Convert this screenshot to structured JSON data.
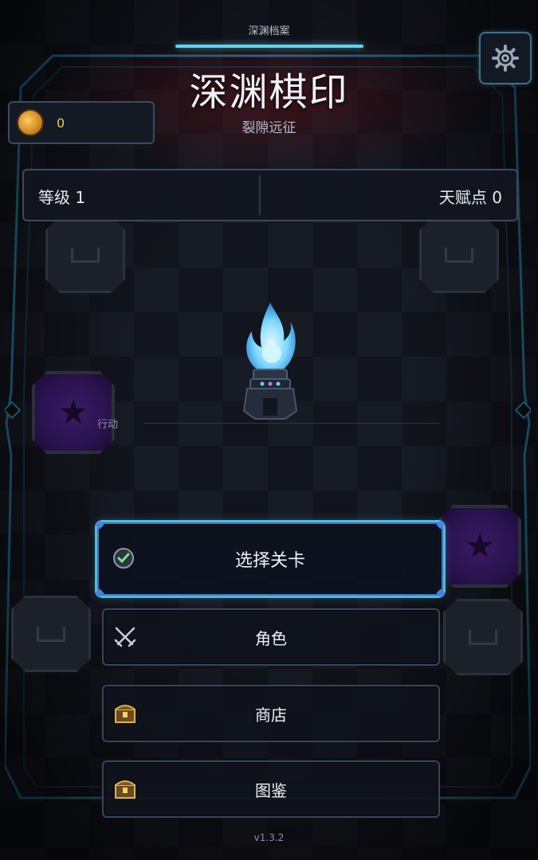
{
  "header": {
    "tab_title": "深渊档案",
    "game_title": "深渊棋印",
    "subtitle": "裂隙远征",
    "settings_icon": "gear-icon"
  },
  "currency": {
    "icon": "coin-icon",
    "value": "0"
  },
  "stats": {
    "level": "等级 1",
    "talent_points": "天赋点 0"
  },
  "board": {
    "action_label": "行动",
    "centerpiece": "blue-flame-brazier-icon"
  },
  "menu": {
    "select_stage": "选择关卡",
    "character": "角色",
    "shop": "商店",
    "codex": "图鉴"
  },
  "footer": {
    "version": "v1.3.2"
  },
  "colors": {
    "accent_cyan": "#5fd3f0",
    "primary_border": "#3a78c8",
    "coin_gold": "#f2c557",
    "portal_purple": "#3a1b66"
  }
}
